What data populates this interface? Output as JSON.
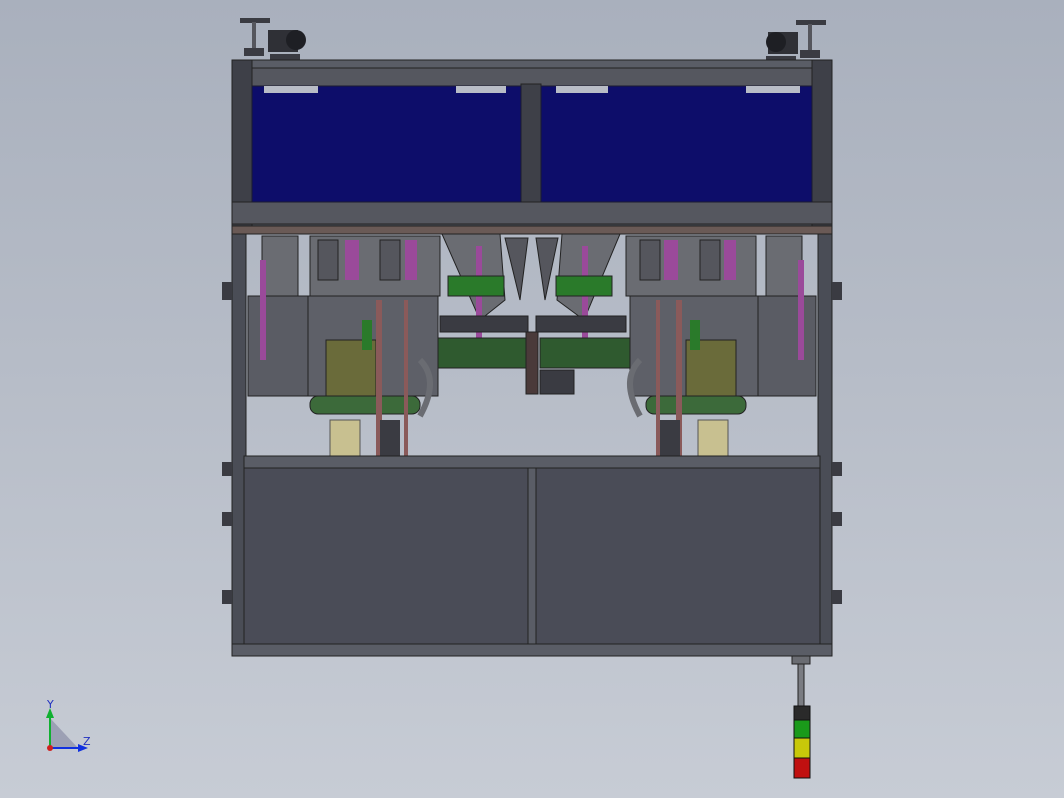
{
  "view": {
    "background_top": "#a9b0bd",
    "background_bottom": "#c7ccd5"
  },
  "triad": {
    "axis_y_label": "Y",
    "axis_z_label": "Z",
    "axis_y_color": "#10b030",
    "axis_z_color": "#1030e0",
    "origin_color": "#d02020"
  },
  "model": {
    "frame_color": "#4a4d56",
    "panel_color": "#4a4c57",
    "window_color": "#0d0d6a",
    "mechanism_color": "#6a6c72",
    "purple_color": "#9a4a9a",
    "green_color": "#2a7a2a",
    "olive_color": "#b8b080",
    "signal_tower_colors": [
      "#2a2a2a",
      "#1a9a1a",
      "#c8c80a",
      "#c01010"
    ]
  }
}
